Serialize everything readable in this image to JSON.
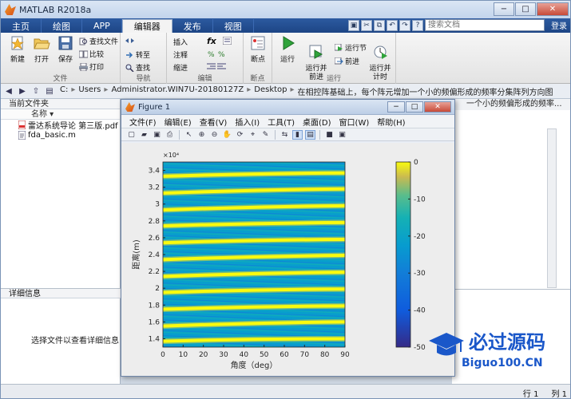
{
  "window": {
    "title": "MATLAB R2018a"
  },
  "tabs": [
    {
      "label": "主页"
    },
    {
      "label": "绘图"
    },
    {
      "label": "APP"
    },
    {
      "label": "编辑器"
    },
    {
      "label": "发布"
    },
    {
      "label": "视图"
    }
  ],
  "search": {
    "placeholder": "搜索文档",
    "login_label": "登录"
  },
  "ribbon": {
    "file_group": {
      "label": "文件",
      "new": "新建",
      "open": "打开",
      "save": "保存",
      "find_files": "查找文件",
      "compare": "比较",
      "print": "打印"
    },
    "nav_group": {
      "label": "导航",
      "goto": "转至",
      "find": "查找"
    },
    "edit_group": {
      "label": "编辑",
      "insert": "插入",
      "comment": "注释",
      "indent": "缩进",
      "fx": "fx"
    },
    "breakpoint_group": {
      "label": "断点",
      "breakpoints": "断点"
    },
    "run_group": {
      "label": "运行",
      "run": "运行",
      "run_advance": "运行并\n前进",
      "run_section": "运行节",
      "advance": "前进",
      "run_time": "运行并\n计时"
    }
  },
  "address": {
    "path": [
      "C:",
      "Users",
      "Administrator.WIN7U-20180127Z",
      "Desktop",
      "在相控阵基础上，每个阵元增加一个小的频偏形成的频率分集阵列方向图"
    ]
  },
  "left_panel": {
    "title": "当前文件夹",
    "column": "名称",
    "files": [
      {
        "name": "雷达系统导论 第三版.pdf",
        "type": "pdf"
      },
      {
        "name": "fda_basic.m",
        "type": "m"
      }
    ],
    "details_title": "详细信息",
    "details_hint": "选择文件以查看详细信息"
  },
  "right_panel": {
    "title_fragment": "一个小的频偏形成的频率..."
  },
  "figure": {
    "title": "Figure 1",
    "menu": [
      "文件(F)",
      "编辑(E)",
      "查看(V)",
      "插入(I)",
      "工具(T)",
      "桌面(D)",
      "窗口(W)",
      "帮助(H)"
    ]
  },
  "chart_data": {
    "type": "heatmap",
    "title": "",
    "xlabel": "角度（deg）",
    "ylabel": "距离(m)",
    "xlim": [
      0,
      90
    ],
    "ylim": [
      13000,
      35000
    ],
    "y_exponent": "×10⁴",
    "x_ticks": [
      0,
      10,
      20,
      30,
      40,
      50,
      60,
      70,
      80,
      90
    ],
    "y_ticks": [
      1.4,
      1.6,
      1.8,
      2.0,
      2.2,
      2.4,
      2.6,
      2.8,
      3.0,
      3.2,
      3.4
    ],
    "y_tick_labels": [
      "1.4",
      "1.6",
      "1.8",
      "2",
      "2.2",
      "2.4",
      "2.6",
      "2.8",
      "3",
      "3.2",
      "3.4"
    ],
    "colorbar": {
      "min": -50,
      "max": 0,
      "ticks": [
        0,
        -10,
        -20,
        -30,
        -40,
        -50
      ]
    },
    "colormap": "parula",
    "main_lobe_ranges_at_0deg": [
      13700,
      15500,
      17500,
      19500,
      21400,
      23400,
      25400,
      27400,
      29300,
      31300,
      33300
    ],
    "main_lobe_ranges_at_90deg": [
      14000,
      16000,
      17900,
      19900,
      21900,
      23900,
      25800,
      27800,
      29800,
      31800,
      33700
    ]
  },
  "status": {
    "row_label": "行",
    "row_value": "1",
    "col_label": "列",
    "col_value": "1"
  },
  "watermark": {
    "text1": "必过源码",
    "text2": "Biguo100.CN"
  },
  "colors": {
    "ribbon_blue": "#1d4585",
    "accent_orange": "#e8861a",
    "watermark_blue": "#1a57c9",
    "watermark_red": "#e02222"
  }
}
